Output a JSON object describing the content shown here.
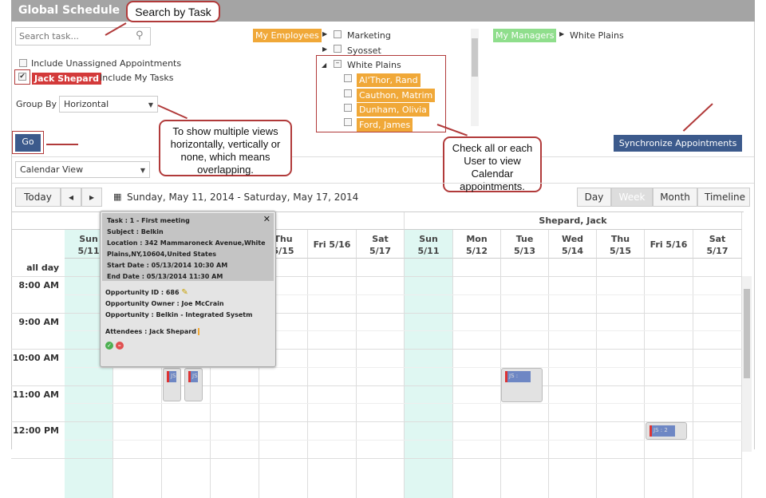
{
  "title": "Global Schedule",
  "search": {
    "placeholder": "Search task..."
  },
  "options": {
    "include_unassigned": "Include Unassigned Appointments",
    "user_tag": "Jack Shepard",
    "include_my_tasks": "Include My Tasks",
    "group_by_label": "Group By",
    "group_by_value": "Horizontal",
    "go_label": "Go",
    "view_select": "Calendar View"
  },
  "employees": {
    "tag": "My Employees",
    "groups": [
      "Marketing",
      "Syosset",
      "White Plains"
    ],
    "people": [
      "Al'Thor, Rand",
      "Cauthon, Matrim",
      "Dunham, Olivia",
      "Ford, James"
    ]
  },
  "managers": {
    "tag": "My Managers",
    "location": "White Plains"
  },
  "sync_label": "Synchronize Appointments",
  "callouts": {
    "search": "Search by Task",
    "views": "To show multiple views horizontally, vertically or none, which means overlapping.",
    "users": "Check all or each User to view Calendar appointments."
  },
  "toolbar": {
    "today": "Today",
    "prev": "◂",
    "next": "▸",
    "range": "Sunday, May 11, 2014 - Saturday, May 17, 2014",
    "views": [
      "Day",
      "Week",
      "Month",
      "Timeline"
    ],
    "active_view": "Week"
  },
  "calendar": {
    "resource_right": "Shepard, Jack",
    "days_left_partial": [
      "Sun",
      "5/11"
    ],
    "days_left": [
      [
        "Thu",
        "5/15"
      ],
      [
        "Fri 5/16",
        ""
      ],
      [
        "Sat",
        "5/17"
      ]
    ],
    "days_right": [
      [
        "Sun",
        "5/11"
      ],
      [
        "Mon",
        "5/12"
      ],
      [
        "Tue",
        "5/13"
      ],
      [
        "Wed",
        "5/14"
      ],
      [
        "Thu",
        "5/15"
      ],
      [
        "Fri 5/16",
        ""
      ],
      [
        "Sat",
        "5/17"
      ]
    ],
    "allday": "all day",
    "times": [
      "8:00 AM",
      "9:00 AM",
      "10:00 AM",
      "11:00 AM",
      "12:00 PM"
    ],
    "appts": [
      "JS :",
      "JS : 2"
    ]
  },
  "popup": {
    "task": "Task : 1 - First meeting",
    "subject": "Subject : Belkin",
    "location1": "Location : 342 Mammaroneck Avenue,White",
    "location2": "Plains,NY,10604,United States",
    "start": "Start Date : 05/13/2014 10:30 AM",
    "end": "End Date : 05/13/2014 11:30 AM",
    "opp_id": "Opportunity ID : 686",
    "owner": "Opportunity Owner : Joe McCrain",
    "opp": "Opportunity : Belkin - Integrated Sysetm",
    "attendees": "Attendees : Jack Shepard"
  }
}
